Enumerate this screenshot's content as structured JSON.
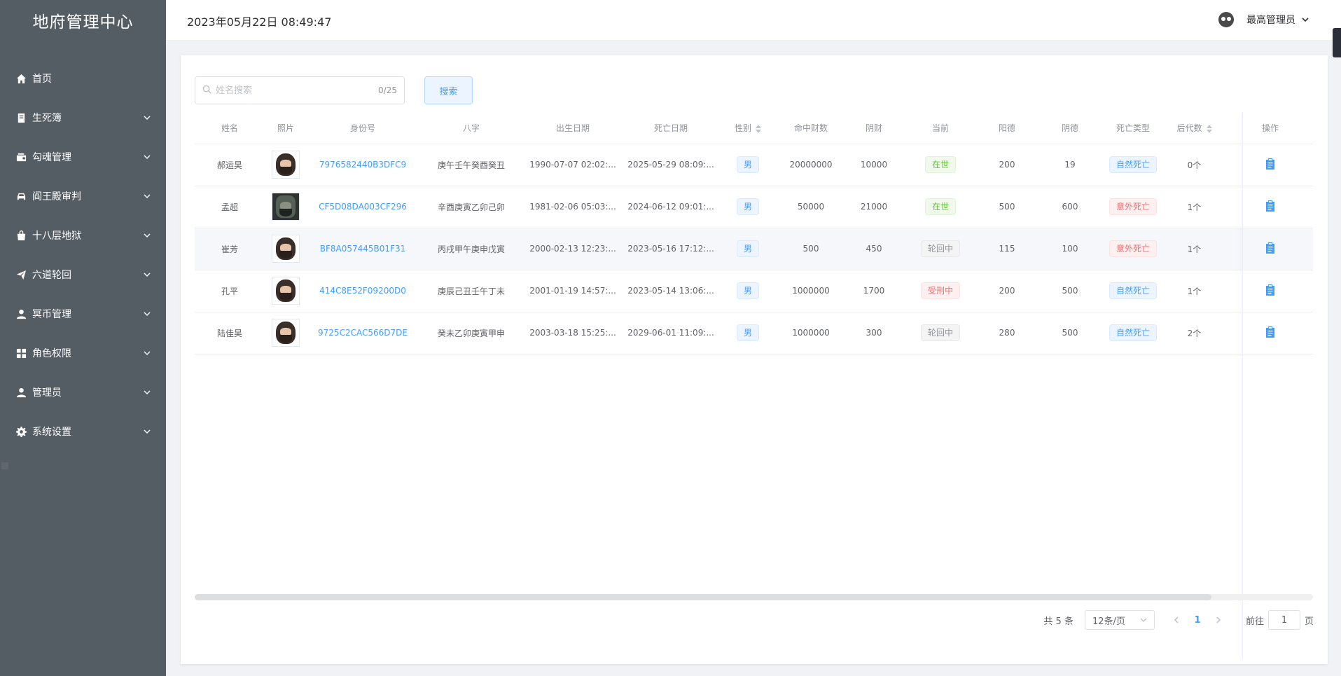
{
  "app": {
    "title": "地府管理中心"
  },
  "header": {
    "datetime": "2023年05月22日 08:49:47",
    "user_name": "最高管理员"
  },
  "sidebar": {
    "items": [
      {
        "label": "首页",
        "icon": "home-icon",
        "expandable": false
      },
      {
        "label": "生死簿",
        "icon": "book-icon",
        "expandable": true
      },
      {
        "label": "勾魂管理",
        "icon": "wallet-icon",
        "expandable": true
      },
      {
        "label": "阎王殿审判",
        "icon": "car-icon",
        "expandable": true
      },
      {
        "label": "十八层地狱",
        "icon": "bag-icon",
        "expandable": true
      },
      {
        "label": "六道轮回",
        "icon": "send-icon",
        "expandable": true
      },
      {
        "label": "冥币管理",
        "icon": "user-icon",
        "expandable": true
      },
      {
        "label": "角色权限",
        "icon": "grid-icon",
        "expandable": true
      },
      {
        "label": "管理员",
        "icon": "user-icon",
        "expandable": true
      },
      {
        "label": "系统设置",
        "icon": "gear-icon",
        "expandable": true
      }
    ]
  },
  "search": {
    "placeholder": "姓名搜索",
    "value": "",
    "counter": "0/25",
    "button_label": "搜索"
  },
  "table": {
    "columns": [
      "姓名",
      "照片",
      "身份号",
      "八字",
      "出生日期",
      "死亡日期",
      "性别",
      "命中财数",
      "阴财",
      "当前",
      "阳德",
      "阴德",
      "死亡类型",
      "后代数",
      "操作"
    ],
    "rows": [
      {
        "name": "郝运昊",
        "photo": "avatar-bearded",
        "id": "7976582440B3DFC9",
        "bazi": "庚午壬午癸酉癸丑",
        "birth": "1990-07-07 02:02:...",
        "death": "2025-05-29 08:09:...",
        "gender": "男",
        "fortune": "20000000",
        "yin_wealth": "10000",
        "status": "在世",
        "status_color": "green",
        "yang_virtue": "200",
        "yin_virtue": "19",
        "death_type": "自然死亡",
        "death_type_color": "blue",
        "descendants": "0个"
      },
      {
        "name": "孟超",
        "photo": "avatar-dark",
        "id": "CF5D08DA003CF296",
        "bazi": "辛酉庚寅乙卯己卯",
        "birth": "1981-02-06 05:03:...",
        "death": "2024-06-12 09:01:...",
        "gender": "男",
        "fortune": "50000",
        "yin_wealth": "21000",
        "status": "在世",
        "status_color": "green",
        "yang_virtue": "500",
        "yin_virtue": "600",
        "death_type": "意外死亡",
        "death_type_color": "red",
        "descendants": "1个"
      },
      {
        "name": "崔芳",
        "photo": "avatar-bearded",
        "id": "BF8A057445B01F31",
        "bazi": "丙戌甲午庚申戊寅",
        "birth": "2000-02-13 12:23:...",
        "death": "2023-05-16 17:12:...",
        "gender": "男",
        "fortune": "500",
        "yin_wealth": "450",
        "status": "轮回中",
        "status_color": "gray",
        "yang_virtue": "115",
        "yin_virtue": "100",
        "death_type": "意外死亡",
        "death_type_color": "red",
        "descendants": "1个"
      },
      {
        "name": "孔平",
        "photo": "avatar-bearded",
        "id": "414C8E52F09200D0",
        "bazi": "庚辰己丑壬午丁未",
        "birth": "2001-01-19 14:57:...",
        "death": "2023-05-14 13:06:...",
        "gender": "男",
        "fortune": "1000000",
        "yin_wealth": "1700",
        "status": "受刑中",
        "status_color": "red",
        "yang_virtue": "200",
        "yin_virtue": "500",
        "death_type": "自然死亡",
        "death_type_color": "blue",
        "descendants": "1个"
      },
      {
        "name": "陆佳昊",
        "photo": "avatar-bearded",
        "id": "9725C2CAC566D7DE",
        "bazi": "癸未乙卯庚寅甲申",
        "birth": "2003-03-18 15:25:...",
        "death": "2029-06-01 11:09:...",
        "gender": "男",
        "fortune": "1000000",
        "yin_wealth": "300",
        "status": "轮回中",
        "status_color": "gray",
        "yang_virtue": "280",
        "yin_virtue": "500",
        "death_type": "自然死亡",
        "death_type_color": "blue",
        "descendants": "2个"
      }
    ],
    "op_icon": "clipboard-icon"
  },
  "pagination": {
    "total_text": "共 5 条",
    "page_size": "12条/页",
    "current_page": "1",
    "goto_prefix": "前往",
    "goto_value": "1",
    "goto_suffix": "页"
  },
  "colors": {
    "sidebar_bg": "#545c64",
    "primary": "#409eff",
    "success": "#67c23a",
    "danger": "#f56c6c",
    "info": "#909399"
  }
}
